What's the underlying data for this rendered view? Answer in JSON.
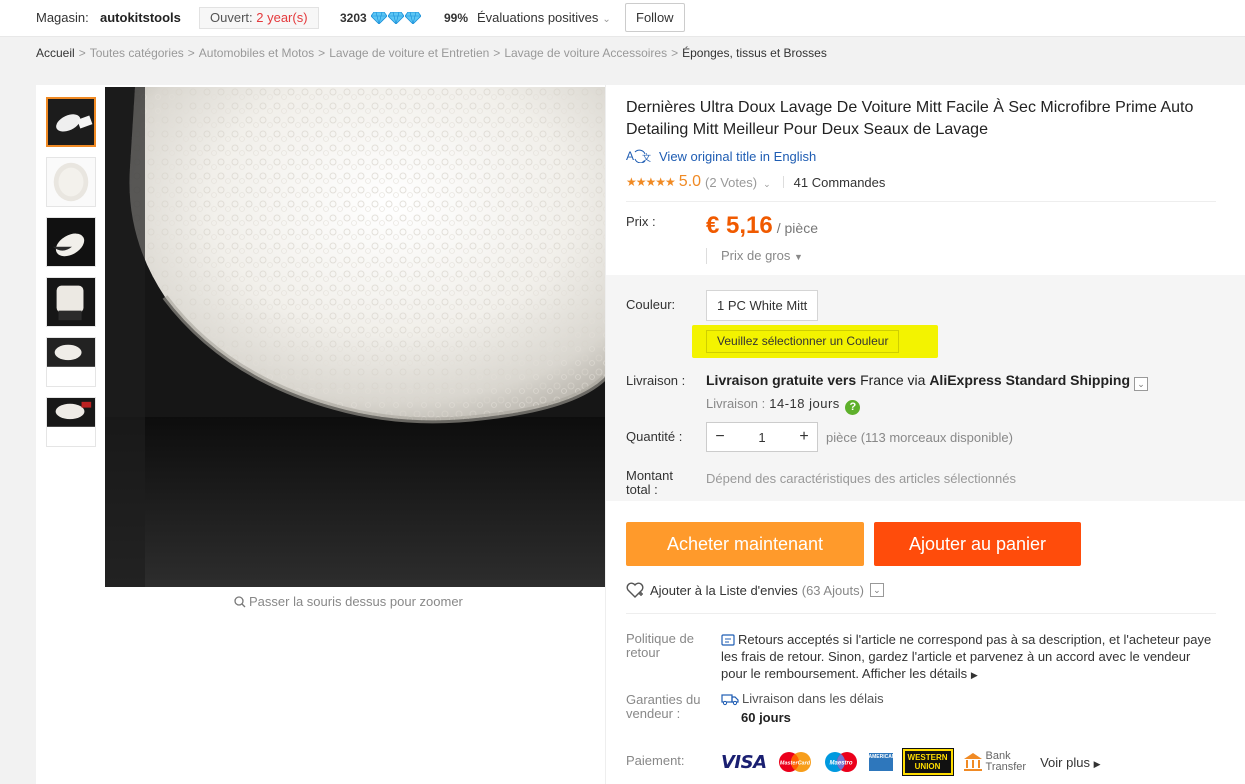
{
  "store": {
    "label": "Magasin:",
    "name": "autokitstools",
    "open_prefix": "Ouvert:",
    "open_years": "2 year(s)",
    "score": "3203",
    "positive_pct": "99%",
    "positive_label": "Évaluations positives",
    "follow": "Follow"
  },
  "breadcrumb": [
    "Accueil",
    "Toutes catégories",
    "Automobiles et Motos",
    "Lavage de voiture et Entretien",
    "Lavage de voiture Accessoires",
    "Éponges, tissus et Brosses"
  ],
  "gallery": {
    "thumbnails_count": 6,
    "active_index": 0,
    "zoom_hint": "Passer la souris dessus pour zoomer"
  },
  "product": {
    "title": "Dernières Ultra Doux Lavage De Voiture Mitt Facile À Sec Microfibre Prime Auto Detailing Mitt Meilleur Pour Deux Seaux de Lavage",
    "view_original": "View original title in English",
    "stars": "★★★★★",
    "rating": "5.0",
    "votes": "(2 Votes)",
    "orders": "41 Commandes"
  },
  "price": {
    "label": "Prix :",
    "value": "€ 5,16",
    "unit": "/ pièce",
    "bulk": "Prix de gros"
  },
  "color": {
    "label": "Couleur:",
    "option": "1 PC White Mitt",
    "warning": "Veuillez sélectionner un Couleur"
  },
  "shipping": {
    "label": "Livraison :",
    "free": "Livraison gratuite vers",
    "dest": "France via",
    "method": "AliExpress Standard Shipping",
    "delivery_label": "Livraison :",
    "delivery_days": "14-18 jours"
  },
  "quantity": {
    "label": "Quantité :",
    "minus": "−",
    "value": "1",
    "plus": "+",
    "available": "pièce (113 morceaux disponible)"
  },
  "total": {
    "label": "Montant total :",
    "value": "Dépend des caractéristiques des articles sélectionnés"
  },
  "actions": {
    "buy_now": "Acheter maintenant",
    "add_to_cart": "Ajouter au panier",
    "wishlist": "Ajouter à la Liste d'envies",
    "wishlist_count": "(63 Ajouts)"
  },
  "policy": {
    "label": "Politique de retour",
    "text": "Retours acceptés si l'article ne correspond pas à sa description, et l'acheteur paye les frais de retour. Sinon, gardez l'article et parvenez à un accord avec le vendeur pour le remboursement.",
    "more": "Afficher les détails"
  },
  "guarantee": {
    "label": "Garanties du vendeur :",
    "text": "Livraison dans les délais",
    "days": "60 jours"
  },
  "payment": {
    "label": "Paiement:",
    "visa": "VISA",
    "mastercard": "MasterCard",
    "maestro": "Maestro",
    "amex": "AMERICAN EXPRESS",
    "wu_line1": "WESTERN",
    "wu_line2": "UNION",
    "bank_line1": "Bank",
    "bank_line2": "Transfer",
    "more": "Voir plus"
  },
  "colors": {
    "orange": "#f05a00",
    "buy_button": "#ff9a2b",
    "cart_button": "#ff4c0b",
    "link_blue": "#1f5db3",
    "highlight": "#f3f300"
  }
}
